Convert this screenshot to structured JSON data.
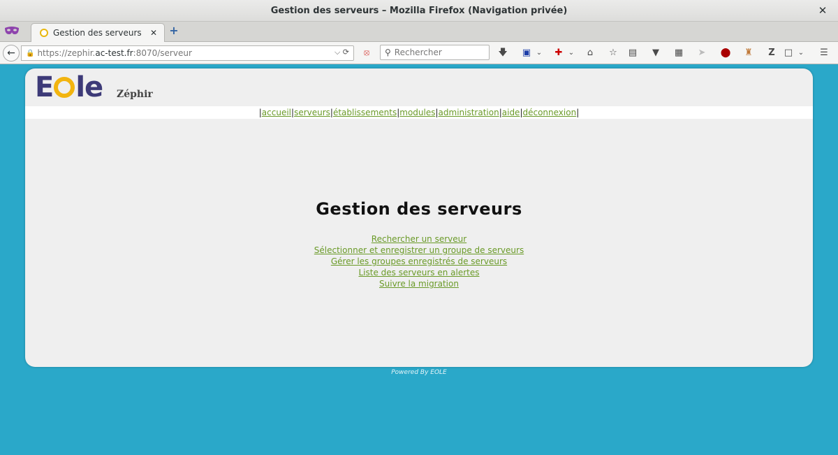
{
  "window": {
    "title": "Gestion des serveurs – Mozilla Firefox (Navigation privée)",
    "close_label": "✕"
  },
  "tabs": [
    {
      "label": "Gestion des serveurs",
      "close_label": "✕"
    }
  ],
  "newtab_label": "+",
  "navbar": {
    "url_scheme": "https://zephir.",
    "url_domain": "ac-test.fr",
    "url_rest": ":8070/serveur",
    "search_placeholder": "Rechercher"
  },
  "site": {
    "logo_text_left": "E",
    "logo_text_right": "le",
    "app_name": "Zéphir"
  },
  "menu": [
    {
      "label": "accueil"
    },
    {
      "label": "serveurs"
    },
    {
      "label": "établissements"
    },
    {
      "label": "modules"
    },
    {
      "label": "administration"
    },
    {
      "label": "aide"
    },
    {
      "label": "déconnexion"
    }
  ],
  "main": {
    "heading": "Gestion des serveurs",
    "links": [
      {
        "label": "Rechercher un serveur"
      },
      {
        "label": "Sélectionner et enregistrer un groupe de serveurs"
      },
      {
        "label": "Gérer les groupes enregistrés de serveurs"
      },
      {
        "label": "Liste des serveurs en alertes"
      },
      {
        "label": "Suivre la migration"
      }
    ]
  },
  "footer": {
    "text": "Powered By EOLE"
  },
  "colors": {
    "page_bg": "#2aa8c9",
    "link": "#6a9a28",
    "logo_purple": "#3d3a78",
    "logo_yellow": "#f2b40f"
  }
}
